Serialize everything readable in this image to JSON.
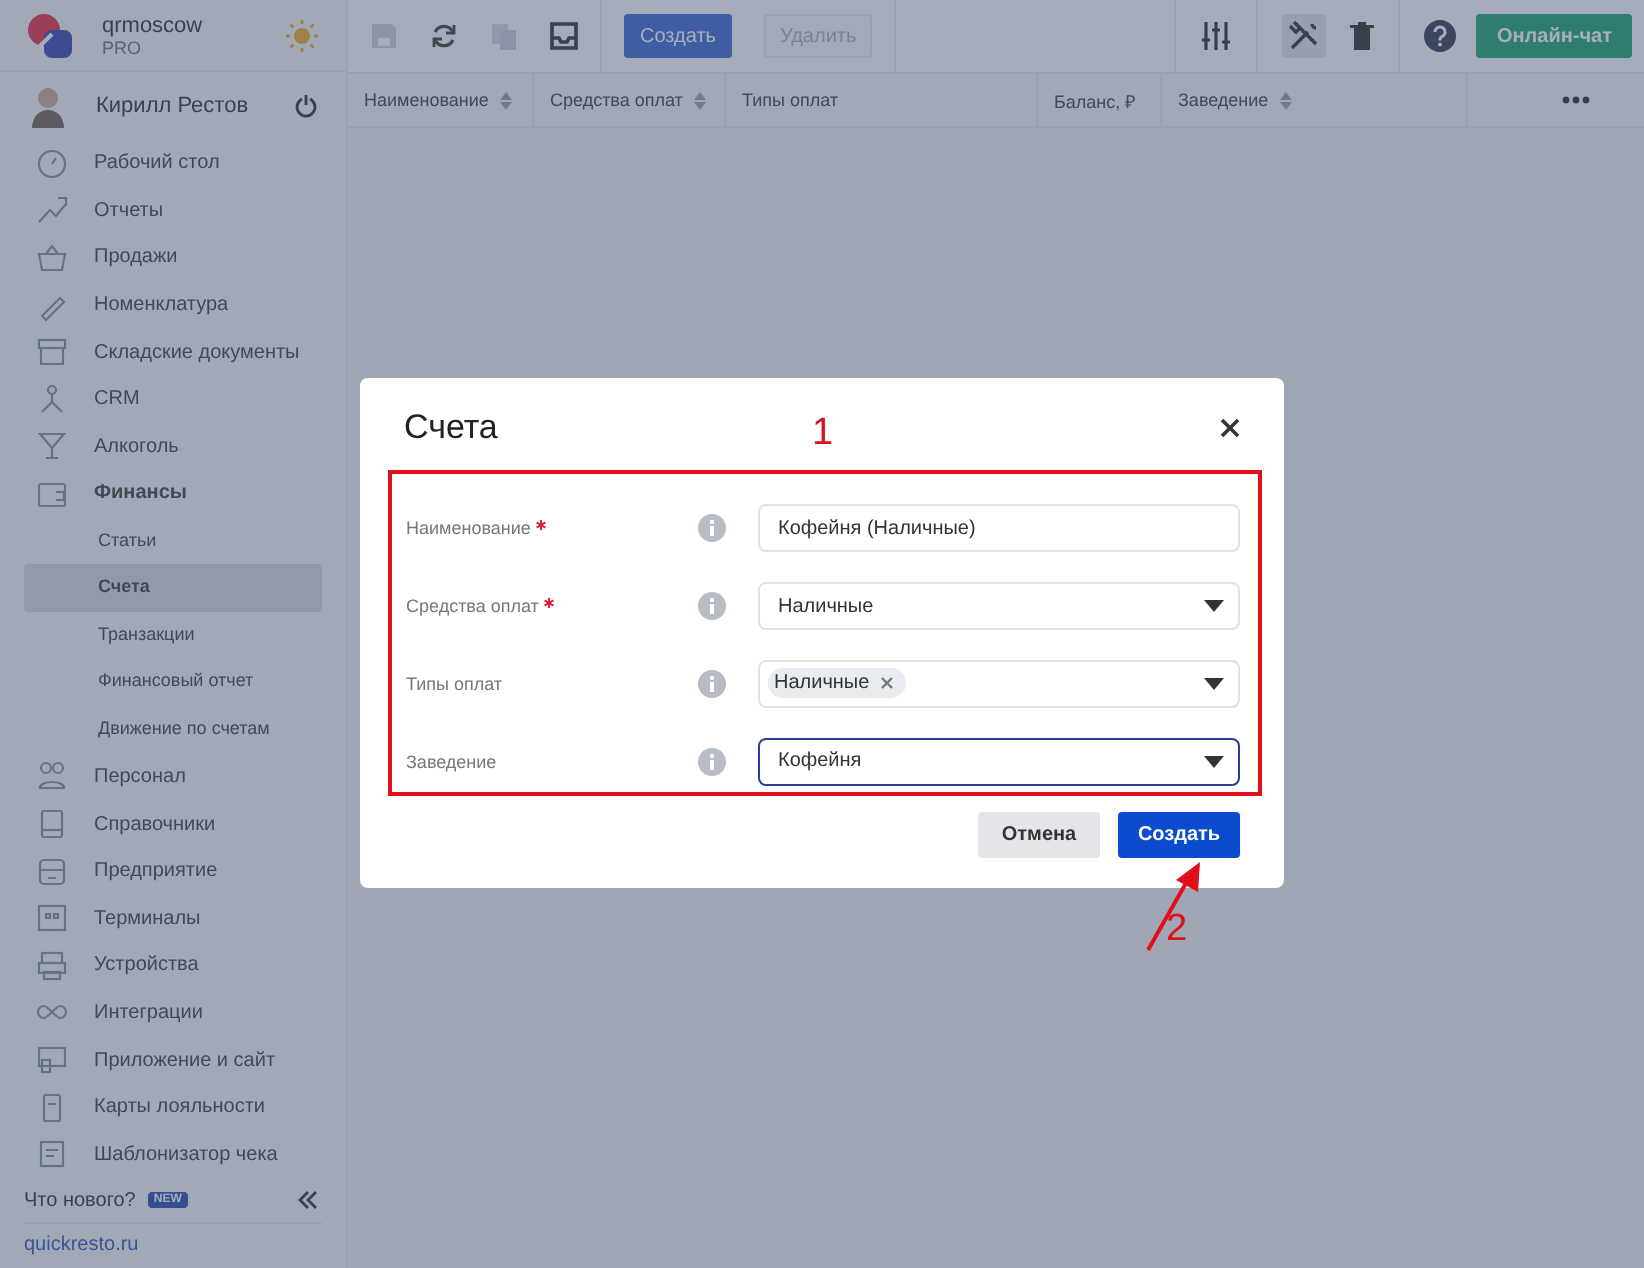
{
  "app": {
    "name": "qrmoscow",
    "plan": "PRO"
  },
  "user": {
    "name": "Кирилл Рестов"
  },
  "sidebar": {
    "items": [
      {
        "label": "Рабочий стол",
        "expanded": false
      },
      {
        "label": "Отчеты",
        "expanded": false
      },
      {
        "label": "Продажи",
        "expanded": false
      },
      {
        "label": "Номенклатура",
        "expanded": false
      },
      {
        "label": "Складские документы",
        "expanded": false
      },
      {
        "label": "CRM",
        "expanded": false
      },
      {
        "label": "Алкоголь",
        "expanded": false
      },
      {
        "label": "Финансы",
        "expanded": true,
        "children": [
          {
            "label": "Статьи",
            "selected": false
          },
          {
            "label": "Счета",
            "selected": true
          },
          {
            "label": "Транзакции",
            "selected": false
          },
          {
            "label": "Финансовый отчет",
            "selected": false
          },
          {
            "label": "Движение по счетам",
            "selected": false
          }
        ]
      },
      {
        "label": "Персонал",
        "expanded": false
      },
      {
        "label": "Справочники",
        "expanded": false
      },
      {
        "label": "Предприятие",
        "expanded": false
      },
      {
        "label": "Терминалы",
        "expanded": false
      },
      {
        "label": "Устройства",
        "expanded": false
      },
      {
        "label": "Интеграции",
        "expanded": false
      },
      {
        "label": "Приложение и сайт",
        "expanded": false
      },
      {
        "label": "Карты лояльности",
        "expanded": false
      },
      {
        "label": "Шаблонизатор чека",
        "expanded": false
      }
    ],
    "whats_new": "Что нового?",
    "badge": "NEW",
    "link": "quickresto.ru"
  },
  "toolbar": {
    "create": {
      "label": "Создать",
      "disabled": false
    },
    "delete": {
      "label": "Удалить",
      "disabled": true
    },
    "chat": "Онлайн-чат"
  },
  "table": {
    "columns": [
      {
        "label": "Наименование",
        "sortable": true
      },
      {
        "label": "Средства оплат",
        "sortable": true
      },
      {
        "label": "Типы оплат",
        "sortable": false
      },
      {
        "label": "Баланс, ₽",
        "sortable": false
      },
      {
        "label": "Заведение",
        "sortable": true
      }
    ]
  },
  "dialog": {
    "title": "Счета",
    "fields": [
      {
        "kind": "text",
        "label": "Наименование",
        "required": true,
        "value": "Кофейня (Наличные)",
        "focused": false
      },
      {
        "kind": "select",
        "label": "Средства оплат",
        "required": true,
        "value": "Наличные",
        "focused": false
      },
      {
        "kind": "tags",
        "label": "Типы оплат",
        "required": false,
        "tags": [
          "Наличные"
        ],
        "focused": false
      },
      {
        "kind": "select",
        "label": "Заведение",
        "required": false,
        "value": "Кофейня",
        "focused": true
      }
    ],
    "cancel": "Отмена",
    "submit": "Создать"
  },
  "annotations": [
    "1",
    "2"
  ]
}
